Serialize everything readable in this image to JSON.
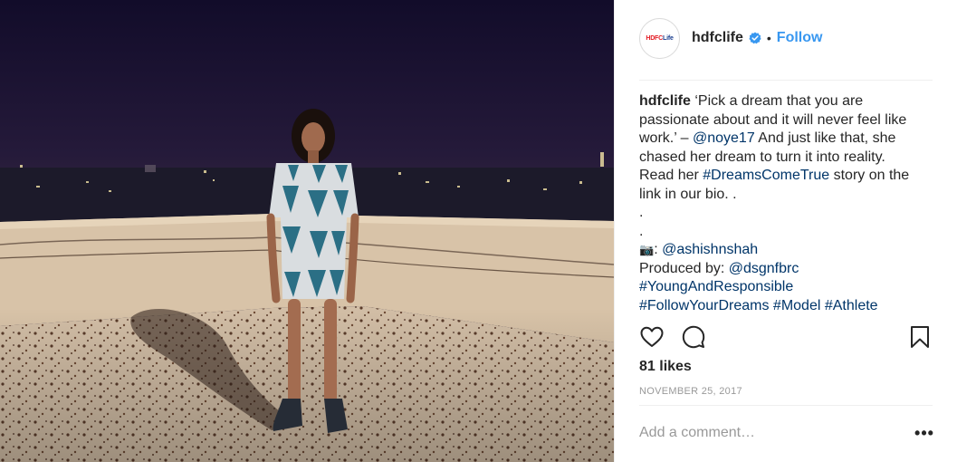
{
  "post": {
    "username": "hdfclife",
    "follow_label": "Follow",
    "separator": "•",
    "avatar_logo": {
      "part_a": "HDFC",
      "part_b": "Life"
    },
    "caption": {
      "user": "hdfclife",
      "line1_rest": " ‘Pick a dream that you are",
      "line2": "passionate about and it will never feel like",
      "line3_pre": "work.’ – ",
      "line3_mention": "@noye17",
      "line3_post": " And just like that, she",
      "line4": "chased her dream to turn it into reality.",
      "line5_pre": "Read her ",
      "line5_tag": "#DreamsComeTrue",
      "line5_post": " story on the",
      "line6": "link in our bio. .",
      "line7": ".",
      "line8": ".",
      "line9_icon": "📷",
      "line9_pre": ": ",
      "line9_mention": "@ashishnshah",
      "line10_pre": "Produced by: ",
      "line10_mention": "@dsgnfbrc",
      "line11_tag": "#YoungAndResponsible",
      "line12_tag1": "#FollowYourDreams",
      "line12_tag2": "#Model",
      "line12_tag3": "#Athlete"
    },
    "likes": "81 likes",
    "date": "NOVEMBER 25, 2017",
    "comment_placeholder": "Add a comment…",
    "more_label": "•••"
  },
  "icons": {
    "verified": "verified-badge-icon",
    "like": "heart-icon",
    "comment": "comment-bubble-icon",
    "save": "bookmark-icon",
    "more": "more-options-icon"
  },
  "colors": {
    "link": "#003569",
    "follow": "#3897f0",
    "verified": "#3897f0",
    "muted": "#999999",
    "text": "#262626"
  }
}
